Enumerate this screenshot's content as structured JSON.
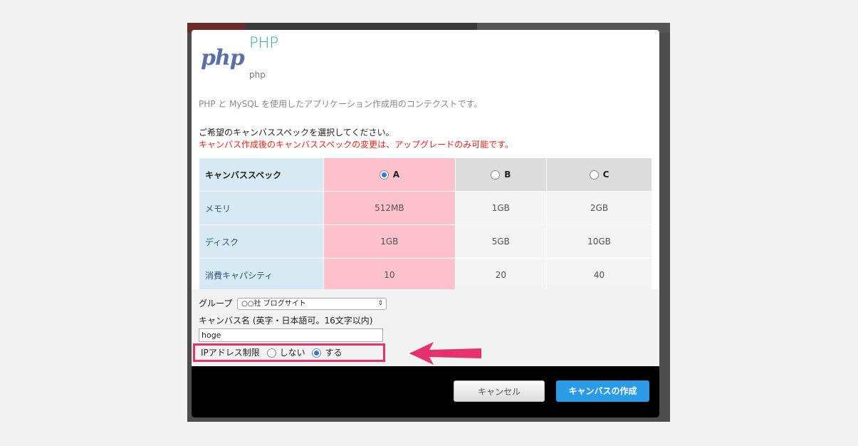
{
  "app": {
    "logo_text": "php",
    "title": "PHP",
    "subtitle": "php",
    "description": "PHP と MySQL を使用したアプリケーション作成用のコンテクストです。"
  },
  "spec": {
    "prompt": "ご希望のキャンバススペックを選択してください。",
    "warning": "キャンバス作成後のキャンバススペックの変更は、アップグレードのみ可能です。",
    "header_label": "キャンバススペック",
    "options": [
      {
        "label": "A",
        "selected": true
      },
      {
        "label": "B",
        "selected": false
      },
      {
        "label": "C",
        "selected": false
      }
    ],
    "rows": [
      {
        "label": "メモリ",
        "values": [
          "512MB",
          "1GB",
          "2GB"
        ]
      },
      {
        "label": "ディスク",
        "values": [
          "1GB",
          "5GB",
          "10GB"
        ]
      },
      {
        "label": "消費キャパシティ",
        "values": [
          "10",
          "20",
          "40"
        ]
      }
    ]
  },
  "form": {
    "group_label": "グループ",
    "group_value": "○○社 ブログサイト",
    "canvas_name_label": "キャンバス名 (英字・日本語可。16文字以内)",
    "canvas_name_value": "hoge",
    "ip_label": "IPアドレス制限",
    "ip_option_no": "しない",
    "ip_option_yes": "する",
    "ip_selected": "yes"
  },
  "buttons": {
    "cancel": "キャンセル",
    "create": "キャンバスの作成"
  },
  "colors": {
    "highlight": "#e5326c",
    "primary": "#2b9be6",
    "selected_column": "#ffc1cb"
  }
}
